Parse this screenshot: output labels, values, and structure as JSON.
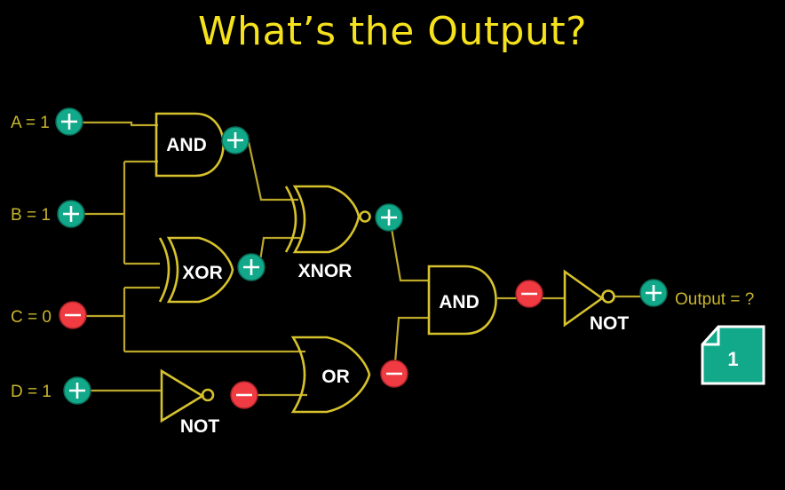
{
  "title": "What’s the Output?",
  "inputs": {
    "a": "A = 1",
    "b": "B = 1",
    "c": "C = 0",
    "d": "D = 1"
  },
  "gates": {
    "and1": "AND",
    "xor": "XOR",
    "xnor": "XNOR",
    "or": "OR",
    "not1": "NOT",
    "and2": "AND",
    "not2": "NOT"
  },
  "output_label": "Output = ?",
  "page_number": "1",
  "colors": {
    "title": "#f5e21c",
    "wire": "#bba82a",
    "high": "#12a88a",
    "low": "#ef3b41"
  }
}
